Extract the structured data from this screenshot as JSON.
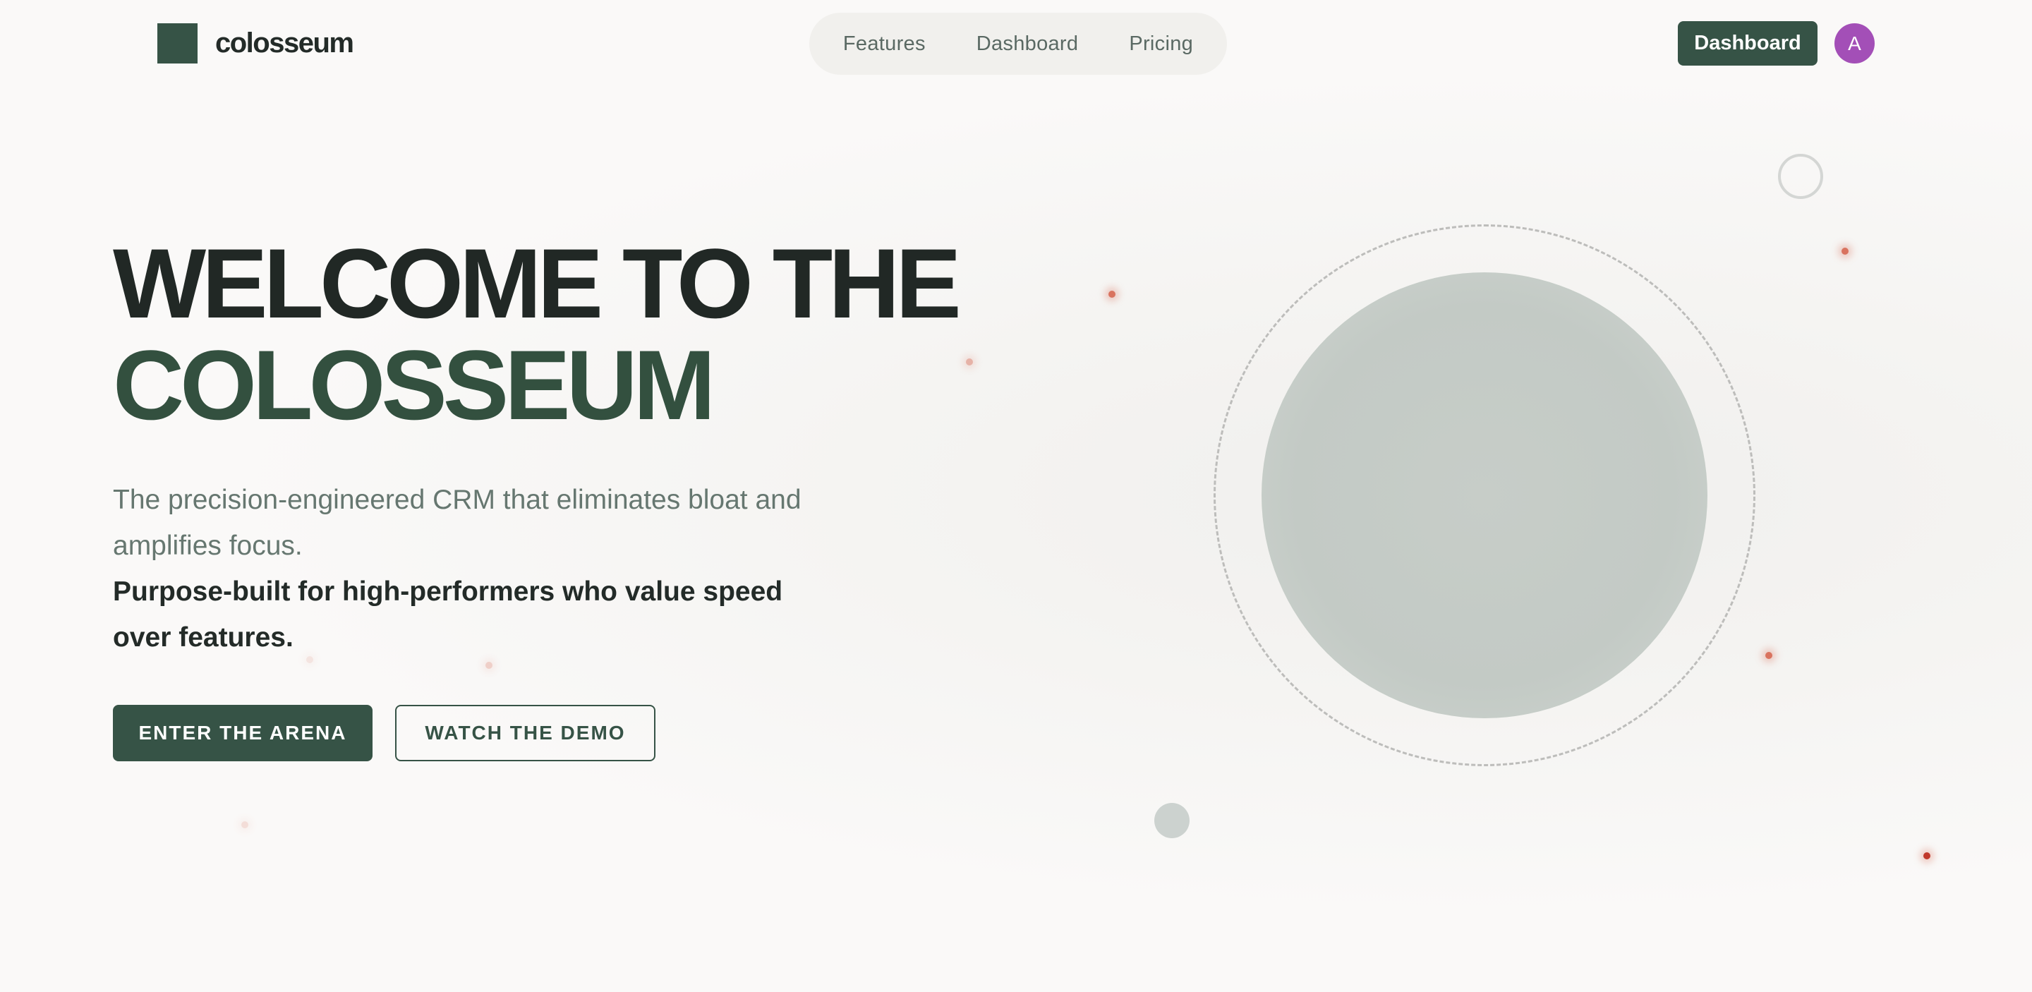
{
  "brand": {
    "name": "colosseum"
  },
  "nav": {
    "items": [
      "Features",
      "Dashboard",
      "Pricing"
    ]
  },
  "header": {
    "dashboard_label": "Dashboard",
    "avatar_initial": "A"
  },
  "hero": {
    "title_line1": "WELCOME TO THE",
    "title_line2": "COLOSSEUM",
    "subtitle": "The precision-engineered CRM that eliminates bloat and amplifies focus.",
    "subtitle_bold": "Purpose-built for high-performers who value speed over features.",
    "primary_cta": "ENTER THE ARENA",
    "secondary_cta": "WATCH THE DEMO"
  },
  "colors": {
    "accent": "#365346",
    "avatar": "#a34fb7",
    "spark": "#d9735f"
  }
}
